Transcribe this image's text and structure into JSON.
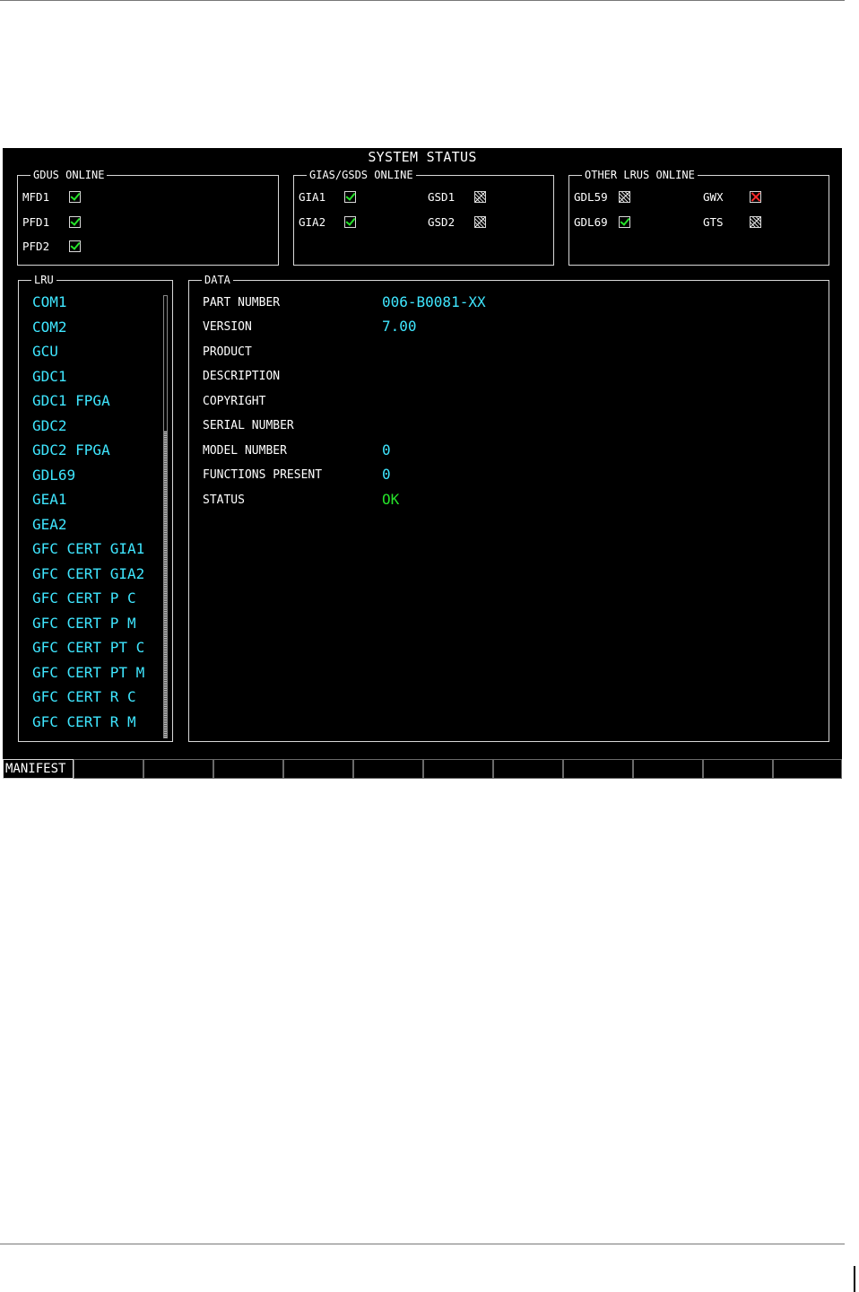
{
  "screen": {
    "title": "SYSTEM STATUS",
    "gdus": {
      "legend": "GDUS ONLINE",
      "items": [
        {
          "label": "MFD1",
          "status": "ok"
        },
        {
          "label": "PFD1",
          "status": "ok"
        },
        {
          "label": "PFD2",
          "status": "ok"
        }
      ]
    },
    "gias": {
      "legend": "GIAS/GSDS ONLINE",
      "items": [
        {
          "label": "GIA1",
          "status": "ok"
        },
        {
          "label": "GIA2",
          "status": "ok"
        },
        {
          "label": "GSD1",
          "status": "not-installed"
        },
        {
          "label": "GSD2",
          "status": "not-installed"
        }
      ]
    },
    "other": {
      "legend": "OTHER LRUS ONLINE",
      "items": [
        {
          "label": "GDL59",
          "status": "not-installed"
        },
        {
          "label": "GDL69",
          "status": "ok"
        },
        {
          "label": "GWX",
          "status": "failed"
        },
        {
          "label": "GTS",
          "status": "not-installed"
        }
      ]
    },
    "lru": {
      "legend": "LRU",
      "items": [
        "COM1",
        "COM2",
        "GCU",
        "GDC1",
        "GDC1 FPGA",
        "GDC2",
        "GDC2 FPGA",
        "GDL69",
        "GEA1",
        "GEA2",
        "GFC CERT GIA1",
        "GFC CERT GIA2",
        "GFC CERT P C",
        "GFC CERT P M",
        "GFC CERT PT C",
        "GFC CERT PT M",
        "GFC CERT R C",
        "GFC CERT R M"
      ]
    },
    "data": {
      "legend": "DATA",
      "rows": [
        {
          "label": "PART NUMBER",
          "value": "006-B0081-XX"
        },
        {
          "label": "VERSION",
          "value": "7.00"
        },
        {
          "label": "PRODUCT",
          "value": ""
        },
        {
          "label": "DESCRIPTION",
          "value": ""
        },
        {
          "label": "COPYRIGHT",
          "value": ""
        },
        {
          "label": "SERIAL NUMBER",
          "value": ""
        },
        {
          "label": "MODEL NUMBER",
          "value": "0"
        },
        {
          "label": "FUNCTIONS PRESENT",
          "value": "0"
        },
        {
          "label": "STATUS",
          "value": "OK"
        }
      ]
    },
    "softkeys": [
      "MANIFEST",
      "",
      "",
      "",
      "",
      "",
      "",
      "",
      "",
      "",
      "",
      ""
    ]
  },
  "colors": {
    "screen_bg": "#000000",
    "cyan_text": "#3fe6ff",
    "ok_green": "#26e22a",
    "fail_red": "#ff2a2a"
  },
  "icons": {
    "ok": "check-icon",
    "not-installed": "hatched-box-icon",
    "failed": "red-x-icon"
  }
}
